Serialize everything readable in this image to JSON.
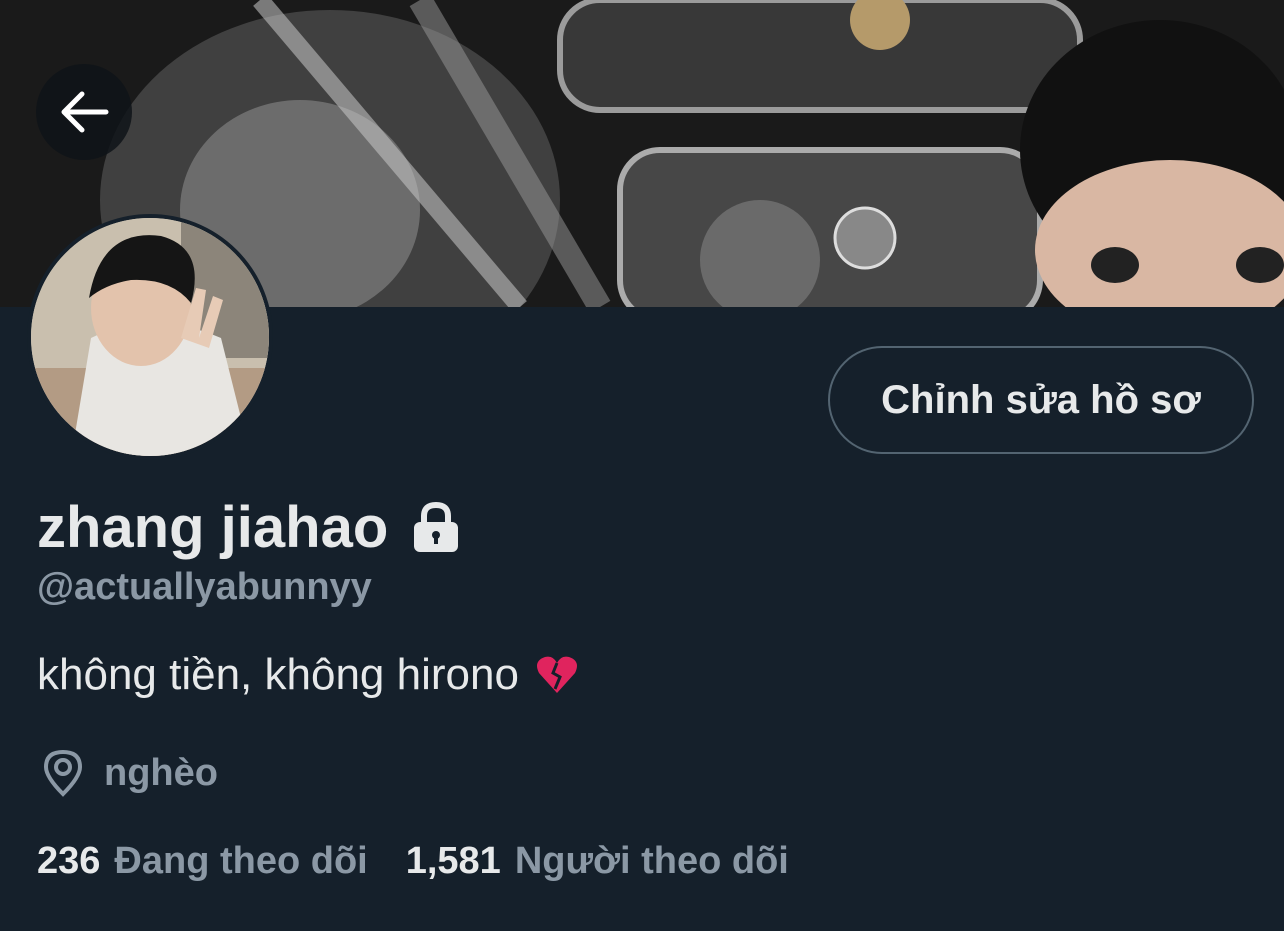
{
  "header": {
    "back_icon": "arrow-left-icon",
    "banner_image": "clear-bags-with-figurines",
    "avatar_image": "user-peace-sign-photo"
  },
  "profile": {
    "edit_button_label": "Chỉnh sửa hồ sơ",
    "display_name": "zhang jiahao",
    "protected_icon": "lock-icon",
    "handle": "@actuallyabunnyy",
    "bio": "không tiền, không hirono",
    "bio_emoji": "broken-heart-icon",
    "location_icon": "location-pin-icon",
    "location": "nghèo"
  },
  "stats": {
    "following_count": "236",
    "following_label": "Đang theo dõi",
    "followers_count": "1,581",
    "followers_label": "Người theo dõi"
  },
  "colors": {
    "background": "#15202b",
    "primary_text": "#e7e9ea",
    "secondary_text": "#8b98a5",
    "border": "#536471",
    "heart": "#e0245e"
  }
}
